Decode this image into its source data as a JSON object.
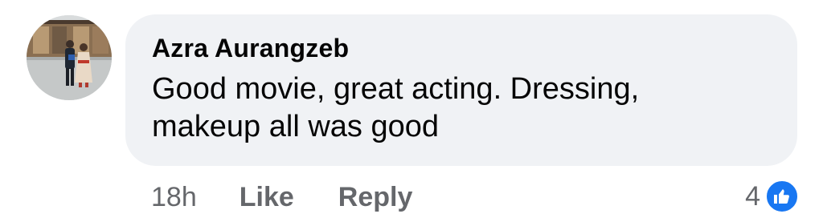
{
  "comment": {
    "author": "Azra Aurangzeb",
    "text": "Good movie, great acting. Dressing, makeup all was good",
    "avatar_icon": "profile-photo"
  },
  "actions": {
    "timestamp": "18h",
    "like_label": "Like",
    "reply_label": "Reply"
  },
  "reactions": {
    "count": "4",
    "type_icon": "like-thumbs-up-icon",
    "badge_color": "#1877f2"
  },
  "colors": {
    "bubble_bg": "#f0f2f5",
    "text_primary": "#050505",
    "text_secondary": "#65676b",
    "accent": "#1877f2"
  }
}
